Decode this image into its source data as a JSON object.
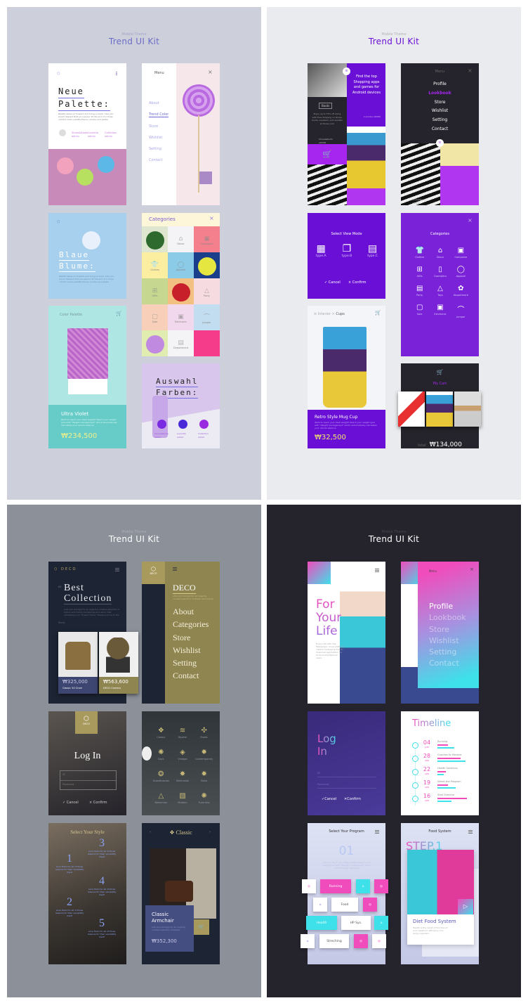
{
  "panels": [
    {
      "subtitle": "Mobile Theme",
      "title": "Trend UI Kit"
    },
    {
      "subtitle": "Mobile Theme",
      "title": "Trend UI Kit"
    },
    {
      "subtitle": "Mobile Theme",
      "title": "Trend UI Kit"
    },
    {
      "subtitle": "Mobile Theme",
      "title": "Trend UI Kit"
    }
  ],
  "colors": {
    "panel1_bg": "#cdd0da",
    "panel2_bg": "#eaebee",
    "panel3_bg": "#8b9099",
    "panel4_bg": "#25242d",
    "accent_lavender": "#6c6cd8",
    "accent_purple": "#6a10d6",
    "accent_gold": "#8f8550",
    "accent_pink": "#f04cbc",
    "accent_cyan": "#3ee0ea"
  },
  "p1": {
    "neue": {
      "title1": "Neue",
      "title2": "Palette:",
      "body": "Palette takes us forward and bring us back. Like you would dessert that you savour at the end of a three colorful meal, palette flavour purple and pastel",
      "authors": [
        "Shoes&Boots admin",
        "Lucentia admin",
        "Collection admin"
      ]
    },
    "menu": {
      "label": "Menu",
      "items": [
        "About",
        "Trend Color",
        "Store",
        "Wishlist",
        "Setting",
        "Contact"
      ],
      "active": "Trend Color"
    },
    "blaue": {
      "title1": "Blaue",
      "title2": "Blume:",
      "body": "Palette takes us forward and bring us back. Like you would dessert that you savour at the end of a three colorful meal, palette flavour purple and pastel"
    },
    "palette": {
      "header": "Color Palette",
      "name": "Ultra Violet",
      "desc": "Want to reach your ideal weight? Reach your weight goal with \"Weight management\" which automatically calculates your calorie balance",
      "price": "₩234,500"
    },
    "categories": {
      "title": "Categories",
      "items": [
        "Decor",
        "Campaine",
        "Clothes",
        "Apparel",
        "Gifts",
        "Party",
        "Sale",
        "Electronic",
        "Jumper",
        "Department"
      ]
    },
    "auswahl": {
      "title1": "Auswahl",
      "title2": "Farben:",
      "authors": [
        "Shoes&Boots admin",
        "Lucentia admin",
        "Collection admin"
      ]
    }
  },
  "p2": {
    "shop": {
      "boots": "Boots",
      "promo": "Enjoy up to 75% off along with Free Shipping on shoes, boots, sneakers, and sandals at Shoes.com",
      "admin1": "Shoes&Boots ADMIN",
      "headline": "Find the top Shopping apps and games for Android devices",
      "admin2": "Lucentia ADMIN",
      "cart_count": "0"
    },
    "menu": {
      "label": "Menu",
      "items": [
        "Profile",
        "Lookbook",
        "Store",
        "Wishlist",
        "Setting",
        "Contact"
      ],
      "active": "Lookbook",
      "admin": "Shoes&Boots ADMIN"
    },
    "viewmode": {
      "title": "Select View Mode",
      "types": [
        "type.A",
        "type.B",
        "type.C"
      ],
      "cancel": "Cancel",
      "confirm": "Confirm"
    },
    "mug": {
      "breadcrumb_parent": "Interior",
      "breadcrumb_sep": ">",
      "breadcrumb_current": "Cups",
      "name": "Retro Style Mug Cup",
      "desc": "Want to reach your ideal weight? Reach your weight goal with \"Weight management\" which automatically calculates your calorie balance",
      "price": "₩32,500"
    },
    "categories": {
      "title": "Categories",
      "items": [
        {
          "icon": "clothes",
          "label": "Clothes"
        },
        {
          "icon": "decor",
          "label": "Decor"
        },
        {
          "icon": "campaine",
          "label": "Campaine"
        },
        {
          "icon": "gifts",
          "label": "Gifts"
        },
        {
          "icon": "cosmetics",
          "label": "Cosmetics"
        },
        {
          "icon": "apparel",
          "label": "Apparel"
        },
        {
          "icon": "party",
          "label": "Party"
        },
        {
          "icon": "toys",
          "label": "Toys"
        },
        {
          "icon": "department",
          "label": "Department"
        },
        {
          "icon": "sale",
          "label": "Sale"
        },
        {
          "icon": "electronic",
          "label": "Electronic"
        },
        {
          "icon": "jumper",
          "label": "Jumper"
        }
      ]
    },
    "cart": {
      "title": "My Cart",
      "total_label": "total",
      "total": "₩134,000"
    }
  },
  "p3": {
    "home": {
      "brand": "DECO",
      "index": "01",
      "title1": "Best",
      "title2": "Collection",
      "desc": "Lots and lovingly for all majority curated selection of stylish and trendy furnishings and décor that refreshing your \"Dream Home\" Treasure trove to life.",
      "items_label": "Items",
      "products": [
        {
          "price": "₩325,000",
          "name": "Classic 50 Chair"
        },
        {
          "price": "₩563,600",
          "name": "DECO Camera"
        }
      ]
    },
    "menu": {
      "brand": "DECO",
      "title": "DECO",
      "desc": "Lots and lovingly for all majority curated selection of stylish and trendy",
      "items": [
        "About",
        "Categories",
        "Store",
        "Wishlist",
        "Setting",
        "Contact"
      ]
    },
    "login": {
      "brand": "DECO",
      "title": "Log In",
      "id_placeholder": "ID",
      "pw_placeholder": "Password",
      "cancel": "Cancel",
      "confirm": "Confirm"
    },
    "styles": [
      "Classic",
      "Hipster",
      "Rustic",
      "Dark",
      "Vintage",
      "Contemporary",
      "Scandinavian",
      "Minimalist",
      "Boho",
      "Bohemian",
      "Modern",
      "Futuristic"
    ],
    "select": {
      "title": "Select Your Style",
      "steps": [
        {
          "n": "1",
          "text": "Love them for all of those reasons for their versatility itself"
        },
        {
          "n": "2",
          "text": "Love them for all of those reasons for their versatility itself"
        },
        {
          "n": "3",
          "text": "Love them for all of those reasons for their versatility itself"
        },
        {
          "n": "4",
          "text": "Love them for all of those reasons for their versatility itself"
        },
        {
          "n": "5",
          "text": "Love them for all of those reasons for their versatility itself"
        }
      ]
    },
    "classic": {
      "title": "Classic",
      "name1": "Classic",
      "name2": "Armchair",
      "desc": "Lots and lovingly for all majority curated selection of stylish",
      "price": "₩352,300"
    }
  },
  "p4": {
    "home": {
      "title1": "For",
      "title2": "Your",
      "title3": "Life",
      "desc": "Enjoy Life with City Messenger. Cross platform instant messaging free to download application for Android smartphone users."
    },
    "menu": {
      "label": "Menu",
      "items": [
        "Profile",
        "Lookbook",
        "Store",
        "Wishlist",
        "Setting",
        "Contact"
      ],
      "active": "Profile"
    },
    "login": {
      "title1": "Log",
      "title2": "In",
      "id_placeholder": "ID",
      "pw_placeholder": "Password",
      "cancel": "Cancel",
      "confirm": "Confirm"
    },
    "timeline": {
      "title": "Timeline",
      "entries": [
        {
          "day": "04",
          "month": "JUN",
          "label": "Running",
          "pink": 0.35,
          "cyan": 0.55
        },
        {
          "day": "28",
          "month": "APR",
          "label": "Coaches to lifestyle",
          "pink": 0.75,
          "cyan": 0.9
        },
        {
          "day": "22",
          "month": "APR",
          "label": "Health Solutions",
          "pink": 0.28,
          "cyan": 0.2
        },
        {
          "day": "19",
          "month": "APR",
          "label": "Select the Program",
          "pink": 0.35,
          "cyan": 0.6
        },
        {
          "day": "16",
          "month": "APR",
          "label": "Start Exercise",
          "pink": 0.95,
          "cyan": 0.45
        }
      ]
    },
    "program": {
      "title": "Select Your Program",
      "index": "01",
      "desc": "Want to reach your ideal weight? Reach your weight goal with \"Weight management\" which automatically calculates",
      "tiles": [
        "Running",
        "Food",
        "Health",
        "HP Sys.",
        "Streching"
      ]
    },
    "food": {
      "title": "Food System",
      "step": "STEP.1",
      "name": "Diet Food System",
      "desc": "Health is the result of function of and metabolic efficiency of a living organism."
    }
  }
}
